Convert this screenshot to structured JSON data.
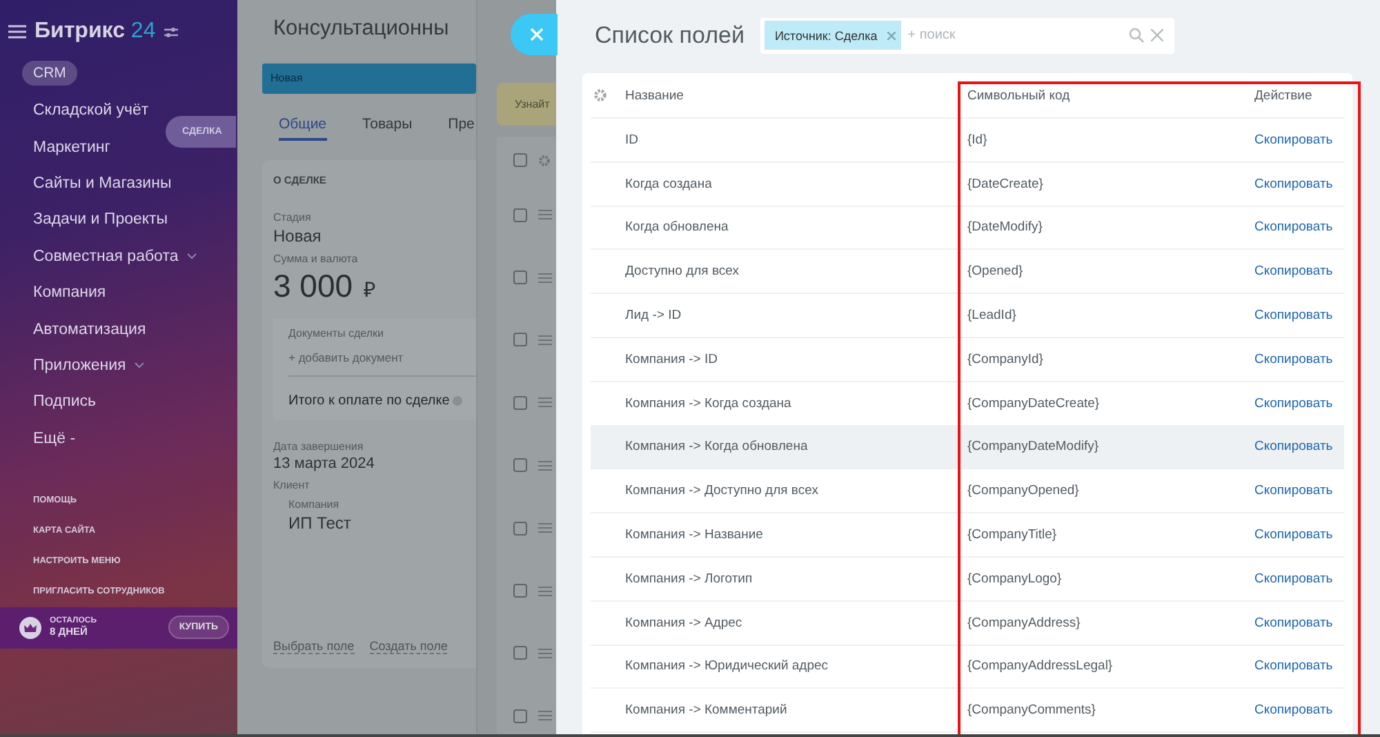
{
  "sidebar": {
    "logo": {
      "name": "Битрикс",
      "number": "24"
    },
    "items": [
      {
        "label": "CRM",
        "selected": true,
        "expandable": false
      },
      {
        "label": "Складской учёт",
        "selected": false,
        "expandable": false
      },
      {
        "label": "Маркетинг",
        "selected": false,
        "expandable": false
      },
      {
        "label": "Сайты и Магазины",
        "selected": false,
        "expandable": false
      },
      {
        "label": "Задачи и Проекты",
        "selected": false,
        "expandable": false
      },
      {
        "label": "Совместная работа",
        "selected": false,
        "expandable": true
      },
      {
        "label": "Компания",
        "selected": false,
        "expandable": false
      },
      {
        "label": "Автоматизация",
        "selected": false,
        "expandable": false
      },
      {
        "label": "Приложения",
        "selected": false,
        "expandable": true
      },
      {
        "label": "Подпись",
        "selected": false,
        "expandable": false
      },
      {
        "label": "Ещё -",
        "selected": false,
        "expandable": false
      }
    ],
    "footer_links": [
      "ПОМОЩЬ",
      "КАРТА САЙТА",
      "НАСТРОИТЬ МЕНЮ",
      "ПРИГЛАСИТЬ СОТРУДНИКОВ"
    ],
    "trial": {
      "caption": "ОСТАЛОСЬ",
      "days": "8 ДНЕЙ",
      "button": "КУПИТЬ"
    }
  },
  "side_tab": "СДЕЛКА",
  "deal": {
    "title": "Консультационны",
    "stage": "Новая",
    "tabs": [
      {
        "label": "Общие",
        "selected": true
      },
      {
        "label": "Товары",
        "selected": false
      },
      {
        "label": "Пре",
        "selected": false
      }
    ],
    "section": "О СДЕЛКЕ",
    "stage_label": "Стадия",
    "stage_value": "Новая",
    "amount_label": "Сумма и валюта",
    "amount": "3 000",
    "currency": "₽",
    "documents_label": "Документы сделки",
    "add_document": "+ добавить документ",
    "total": "Итого к оплате по сделке",
    "close_date_label": "Дата завершения",
    "close_date": "13 марта 2024",
    "client_label": "Клиент",
    "company_label": "Компания",
    "company": "ИП Тест",
    "links": [
      "Выбрать поле",
      "Создать поле"
    ]
  },
  "back_panel": {
    "notice": "Узнайт",
    "rows": [
      {
        "checked": false
      },
      {
        "checked": false
      },
      {
        "checked": false
      },
      {
        "checked": false
      },
      {
        "checked": false
      },
      {
        "checked": false
      },
      {
        "checked": false
      },
      {
        "checked": false
      },
      {
        "checked": false
      },
      {
        "checked": false
      }
    ]
  },
  "fields_panel": {
    "title": "Список полей",
    "filter_tag": "Источник: Сделка",
    "search_placeholder": "+ поиск",
    "columns": [
      "Название",
      "Символьный код",
      "Действие"
    ],
    "frame_around_columns": true,
    "rows": [
      {
        "name": "ID",
        "code": "{Id}",
        "action": "Скопировать",
        "hovered": false
      },
      {
        "name": "Когда создана",
        "code": "{DateCreate}",
        "action": "Скопировать",
        "hovered": false
      },
      {
        "name": "Когда обновлена",
        "code": "{DateModify}",
        "action": "Скопировать",
        "hovered": false
      },
      {
        "name": "Доступно для всех",
        "code": "{Opened}",
        "action": "Скопировать",
        "hovered": false
      },
      {
        "name": "Лид -> ID",
        "code": "{LeadId}",
        "action": "Скопировать",
        "hovered": false
      },
      {
        "name": "Компания -> ID",
        "code": "{CompanyId}",
        "action": "Скопировать",
        "hovered": false
      },
      {
        "name": "Компания -> Когда создана",
        "code": "{CompanyDateCreate}",
        "action": "Скопировать",
        "hovered": false
      },
      {
        "name": "Компания -> Когда обновлена",
        "code": "{CompanyDateModify}",
        "action": "Скопировать",
        "hovered": true
      },
      {
        "name": "Компания -> Доступно для всех",
        "code": "{CompanyOpened}",
        "action": "Скопировать",
        "hovered": false
      },
      {
        "name": "Компания -> Название",
        "code": "{CompanyTitle}",
        "action": "Скопировать",
        "hovered": false
      },
      {
        "name": "Компания -> Логотип",
        "code": "{CompanyLogo}",
        "action": "Скопировать",
        "hovered": false
      },
      {
        "name": "Компания -> Адрес",
        "code": "{CompanyAddress}",
        "action": "Скопировать",
        "hovered": false
      },
      {
        "name": "Компания -> Юридический адрес",
        "code": "{CompanyAddressLegal}",
        "action": "Скопировать",
        "hovered": false
      },
      {
        "name": "Компания -> Комментарий",
        "code": "{CompanyComments}",
        "action": "Скопировать",
        "hovered": false
      }
    ]
  }
}
